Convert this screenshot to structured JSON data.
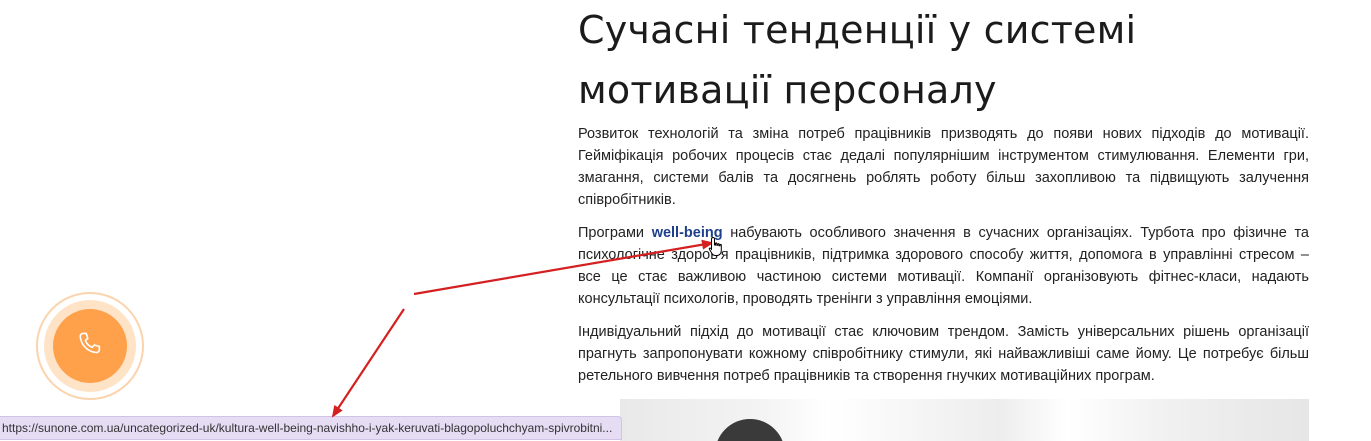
{
  "article": {
    "title": "Сучасні тенденції у системі мотивації персоналу",
    "p1": "Розвиток технологій та зміна потреб працівників призводять до появи нових підходів до мотивації. Гейміфікація робочих процесів стає дедалі популярнішим інструментом стимулювання. Елементи гри, змагання, системи балів та досягнень роблять роботу більш захопливою та підвищують залучення співробітників.",
    "p2_before": "Програми ",
    "p2_link": "well-being",
    "p2_after": " набувають особливого значення в сучасних організаціях. Турбота про фізичне та психологічне здоров'я працівників, підтримка здорового способу життя, допомога в управлінні стресом – все це стає важливою частиною системи мотивації. Компанії організовують фітнес-класи, надають консультації психологів, проводять тренінги з управління емоціями.",
    "p3": "Індивідуальний підхід до мотивації стає ключовим трендом. Замість універсальних рішень організації прагнуть запропонувати кожному співробітнику стимули, які найважливіші саме йому. Це потребує більш ретельного вивчення потреб працівників та створення гнучких мотиваційних програм."
  },
  "status_bar": {
    "url": "https://sunone.com.ua/uncategorized-uk/kultura-well-being-navishho-i-yak-keruvati-blagopoluchchyam-spivrobitni..."
  },
  "call_widget": {
    "icon": "phone-icon"
  },
  "colors": {
    "link": "#1d3f8c",
    "call_button": "#ffa04b",
    "status_bar_bg": "#e6dcf4",
    "annotation_arrow": "#d42020"
  }
}
